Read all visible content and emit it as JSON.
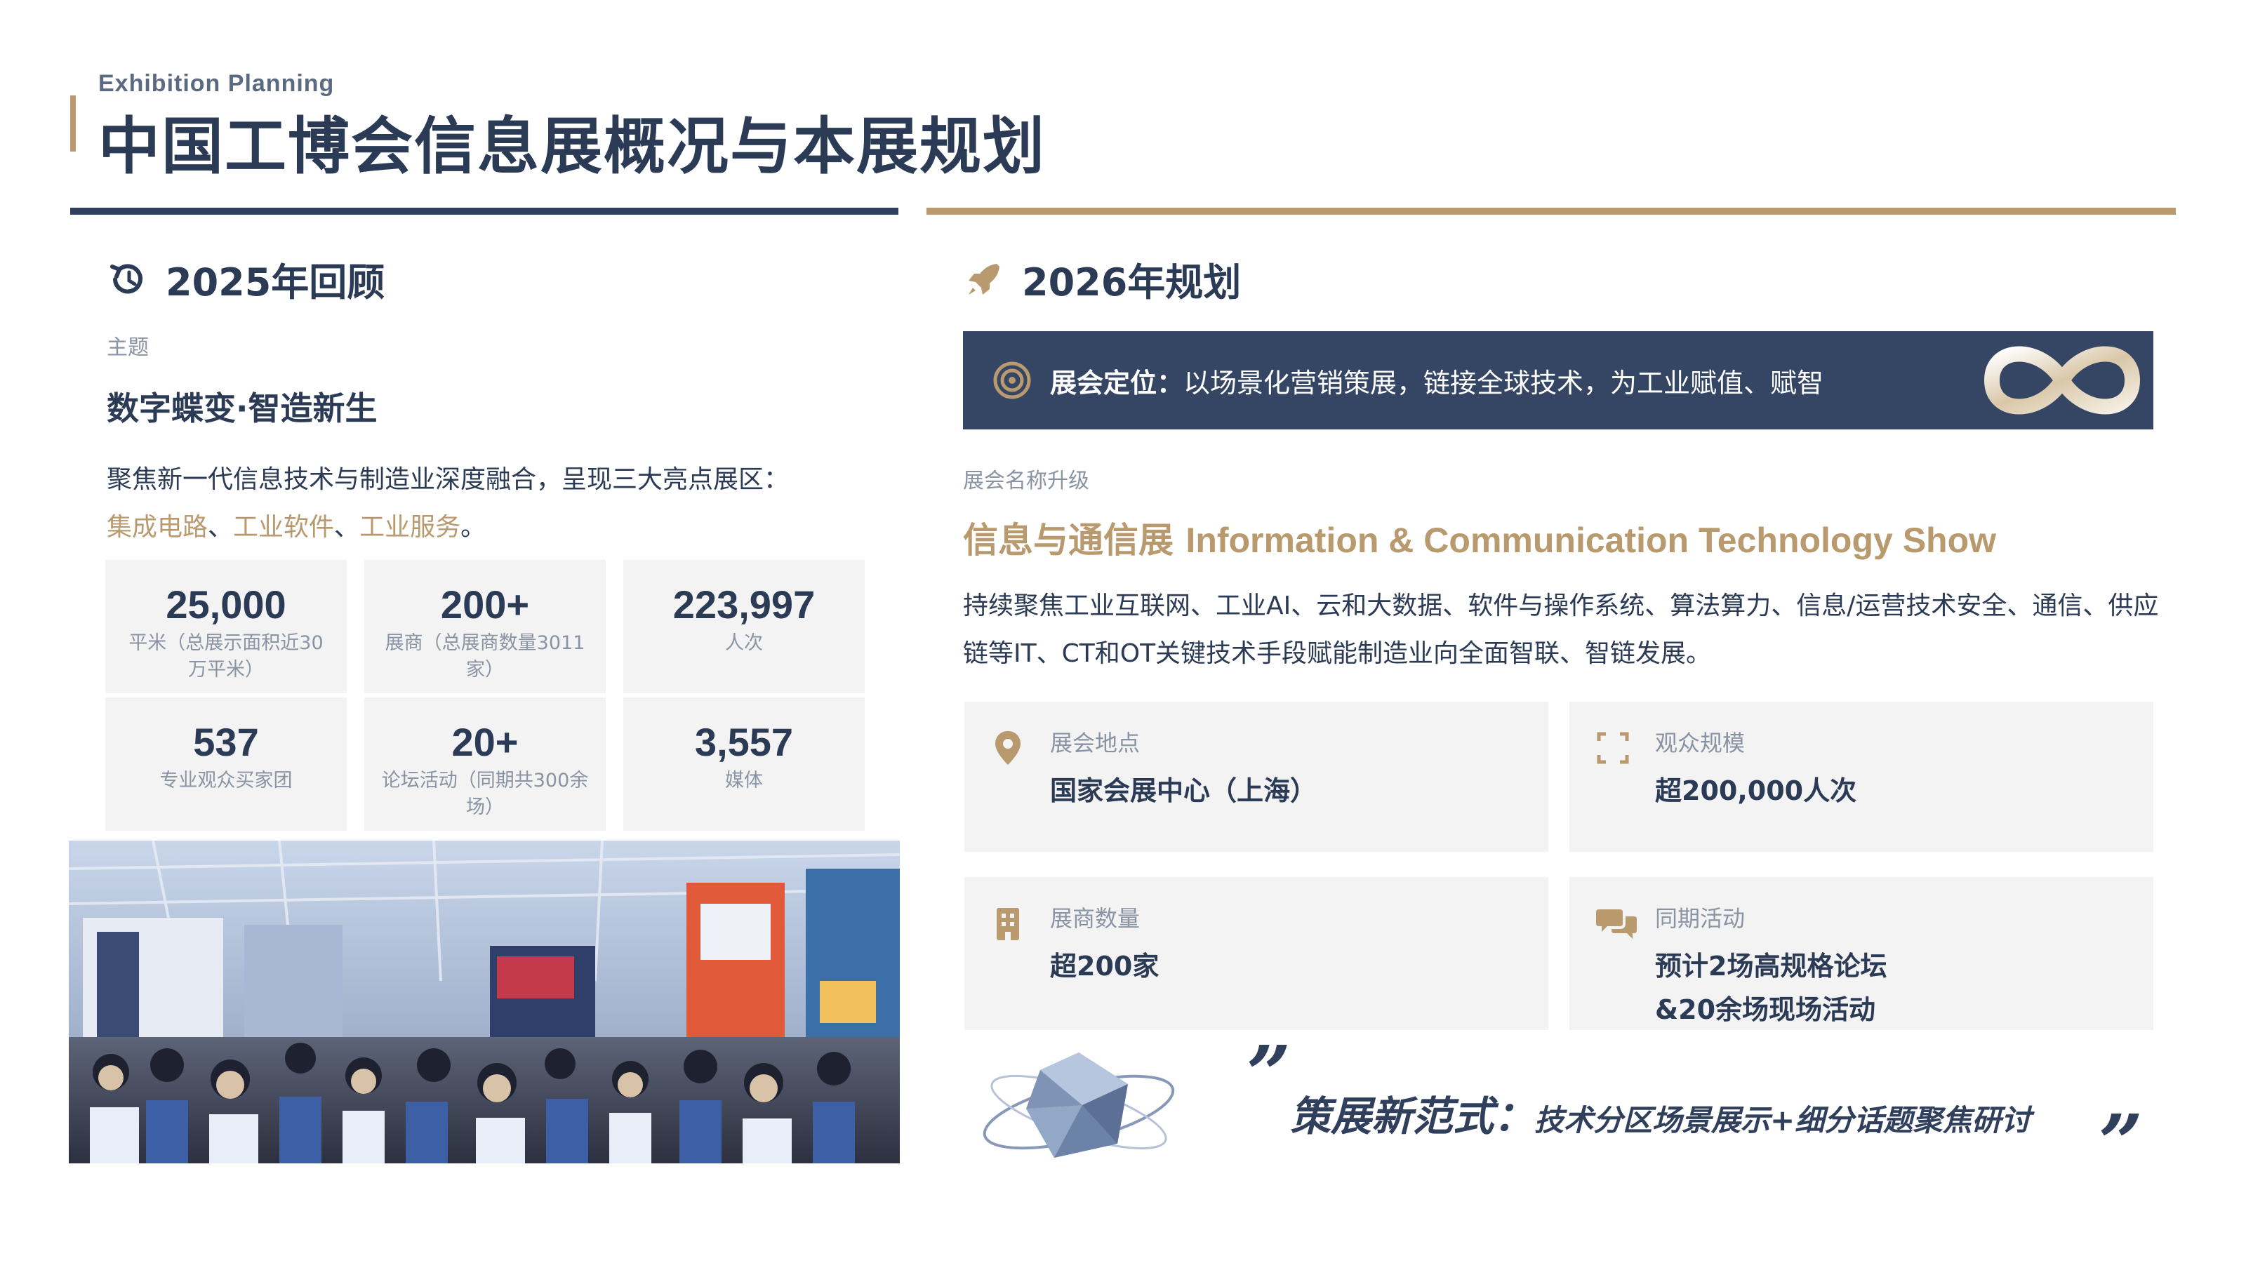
{
  "header": {
    "subtitle_en": "Exhibition Planning",
    "title": "中国工博会信息展概况与本展规划"
  },
  "review": {
    "heading": "2025年回顾",
    "theme_label": "主题",
    "theme": "数字蝶变·智造新生",
    "intro": "聚焦新一代信息技术与制造业深度融合，呈现三大亮点展区：",
    "zones": [
      "集成电路",
      "工业软件",
      "工业服务"
    ],
    "zone_sep": "、",
    "zone_end": "。",
    "stats": [
      {
        "value": "25,000",
        "caption": "平米（总展示面积近30万平米）"
      },
      {
        "value": "200+",
        "caption": "展商（总展商数量3011家）"
      },
      {
        "value": "223,997",
        "caption": "人次"
      },
      {
        "value": "537",
        "caption": "专业观众买家团"
      },
      {
        "value": "20+",
        "caption": "论坛活动（同期共300余场）"
      },
      {
        "value": "3,557",
        "caption": "媒体"
      }
    ]
  },
  "plan": {
    "heading": "2026年规划",
    "positioning_label": "展会定位：",
    "positioning_text": "以场景化营销策展，链接全球技术，为工业赋值、赋智",
    "upgrade_label": "展会名称升级",
    "upgrade_cn": "信息与通信展",
    "upgrade_en": "Information & Communication Technology Show",
    "description": "持续聚焦工业互联网、工业AI、云和大数据、软件与操作系统、算法算力、信息/运营技术安全、通信、供应链等IT、CT和OT关键技术手段赋能制造业向全面智联、智链发展。",
    "cards": [
      {
        "icon": "location-pin-icon",
        "label": "展会地点",
        "value": "国家会展中心（上海）"
      },
      {
        "icon": "expand-frame-icon",
        "label": "观众规模",
        "value": "超200,000人次"
      },
      {
        "icon": "building-icon",
        "label": "展商数量",
        "value": "超200家"
      },
      {
        "icon": "chat-bubbles-icon",
        "label": "同期活动",
        "value": "预计2场高规格论坛",
        "value2": "&20余场现场活动"
      }
    ],
    "slogan_main": "策展新范式：",
    "slogan_sub": "技术分区场景展示+细分话题聚焦研讨",
    "quote_open": "”",
    "quote_close": "”"
  },
  "colors": {
    "navy": "#2b3a55",
    "gold": "#b89a6e",
    "banner": "#354664",
    "card": "#f3f3f3",
    "muted": "#8a93a3"
  }
}
